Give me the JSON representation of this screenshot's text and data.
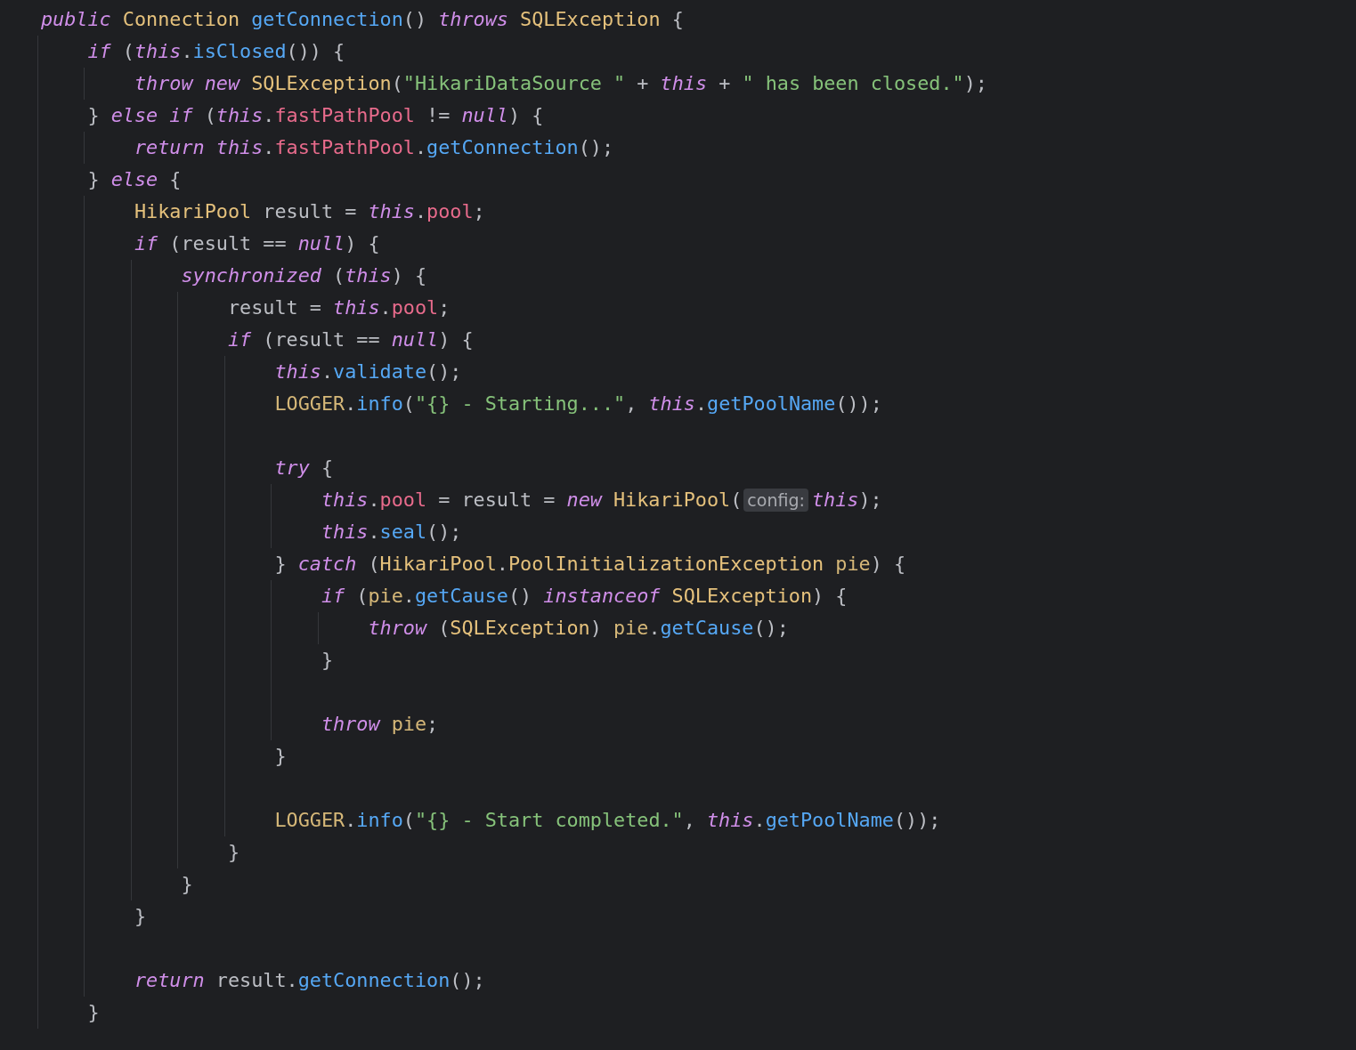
{
  "editor": {
    "lines": [
      {
        "tokens": [
          {
            "kind": "keyword",
            "text": "public"
          },
          {
            "kind": "type",
            "text": "Connection",
            "space_before": true
          },
          {
            "kind": "method",
            "text": "getConnection",
            "space_before": true
          },
          {
            "kind": "plain",
            "text": "() "
          },
          {
            "kind": "keyword",
            "text": "throws"
          },
          {
            "kind": "type",
            "text": "SQLException",
            "space_before": true
          },
          {
            "kind": "plain",
            "text": " {"
          }
        ],
        "children": [
          {
            "tokens": [
              {
                "kind": "keyword",
                "text": "if"
              },
              {
                "kind": "plain",
                "text": " ("
              },
              {
                "kind": "keyword",
                "text": "this"
              },
              {
                "kind": "plain",
                "text": "."
              },
              {
                "kind": "method",
                "text": "isClosed"
              },
              {
                "kind": "plain",
                "text": "()) {"
              }
            ],
            "children": [
              {
                "tokens": [
                  {
                    "kind": "keyword",
                    "text": "throw"
                  },
                  {
                    "kind": "keyword",
                    "text": "new",
                    "space_before": true
                  },
                  {
                    "kind": "type",
                    "text": "SQLException",
                    "space_before": true
                  },
                  {
                    "kind": "plain",
                    "text": "("
                  },
                  {
                    "kind": "string",
                    "text": "\"HikariDataSource \""
                  },
                  {
                    "kind": "plain",
                    "text": " + "
                  },
                  {
                    "kind": "keyword",
                    "text": "this"
                  },
                  {
                    "kind": "plain",
                    "text": " + "
                  },
                  {
                    "kind": "string",
                    "text": "\" has been closed.\""
                  },
                  {
                    "kind": "plain",
                    "text": ");"
                  }
                ]
              }
            ]
          },
          {
            "tokens": [
              {
                "kind": "plain",
                "text": "} "
              },
              {
                "kind": "keyword",
                "text": "else if"
              },
              {
                "kind": "plain",
                "text": " ("
              },
              {
                "kind": "keyword",
                "text": "this"
              },
              {
                "kind": "plain",
                "text": "."
              },
              {
                "kind": "field",
                "text": "fastPathPool"
              },
              {
                "kind": "plain",
                "text": " != "
              },
              {
                "kind": "keyword",
                "text": "null"
              },
              {
                "kind": "plain",
                "text": ") {"
              }
            ],
            "children": [
              {
                "tokens": [
                  {
                    "kind": "keyword",
                    "text": "return"
                  },
                  {
                    "kind": "keyword",
                    "text": "this",
                    "space_before": true
                  },
                  {
                    "kind": "plain",
                    "text": "."
                  },
                  {
                    "kind": "field",
                    "text": "fastPathPool"
                  },
                  {
                    "kind": "plain",
                    "text": "."
                  },
                  {
                    "kind": "method",
                    "text": "getConnection"
                  },
                  {
                    "kind": "plain",
                    "text": "();"
                  }
                ]
              }
            ]
          },
          {
            "tokens": [
              {
                "kind": "plain",
                "text": "} "
              },
              {
                "kind": "keyword",
                "text": "else"
              },
              {
                "kind": "plain",
                "text": " {"
              }
            ],
            "children": [
              {
                "tokens": [
                  {
                    "kind": "type",
                    "text": "HikariPool"
                  },
                  {
                    "kind": "plain",
                    "text": " result = "
                  },
                  {
                    "kind": "keyword",
                    "text": "this"
                  },
                  {
                    "kind": "plain",
                    "text": "."
                  },
                  {
                    "kind": "field",
                    "text": "pool"
                  },
                  {
                    "kind": "plain",
                    "text": ";"
                  }
                ]
              },
              {
                "tokens": [
                  {
                    "kind": "keyword",
                    "text": "if"
                  },
                  {
                    "kind": "plain",
                    "text": " (result == "
                  },
                  {
                    "kind": "keyword",
                    "text": "null"
                  },
                  {
                    "kind": "plain",
                    "text": ") {"
                  }
                ],
                "children": [
                  {
                    "tokens": [
                      {
                        "kind": "keyword",
                        "text": "synchronized"
                      },
                      {
                        "kind": "plain",
                        "text": " ("
                      },
                      {
                        "kind": "keyword",
                        "text": "this"
                      },
                      {
                        "kind": "plain",
                        "text": ") {"
                      }
                    ],
                    "children": [
                      {
                        "tokens": [
                          {
                            "kind": "plain",
                            "text": "result = "
                          },
                          {
                            "kind": "keyword",
                            "text": "this"
                          },
                          {
                            "kind": "plain",
                            "text": "."
                          },
                          {
                            "kind": "field",
                            "text": "pool"
                          },
                          {
                            "kind": "plain",
                            "text": ";"
                          }
                        ]
                      },
                      {
                        "tokens": [
                          {
                            "kind": "keyword",
                            "text": "if"
                          },
                          {
                            "kind": "plain",
                            "text": " (result == "
                          },
                          {
                            "kind": "keyword",
                            "text": "null"
                          },
                          {
                            "kind": "plain",
                            "text": ") {"
                          }
                        ],
                        "children": [
                          {
                            "tokens": [
                              {
                                "kind": "keyword",
                                "text": "this"
                              },
                              {
                                "kind": "plain",
                                "text": "."
                              },
                              {
                                "kind": "method",
                                "text": "validate"
                              },
                              {
                                "kind": "plain",
                                "text": "();"
                              }
                            ]
                          },
                          {
                            "tokens": [
                              {
                                "kind": "variable",
                                "text": "LOGGER"
                              },
                              {
                                "kind": "plain",
                                "text": "."
                              },
                              {
                                "kind": "method",
                                "text": "info"
                              },
                              {
                                "kind": "plain",
                                "text": "("
                              },
                              {
                                "kind": "string",
                                "text": "\"{} - Starting...\""
                              },
                              {
                                "kind": "plain",
                                "text": ", "
                              },
                              {
                                "kind": "keyword",
                                "text": "this"
                              },
                              {
                                "kind": "plain",
                                "text": "."
                              },
                              {
                                "kind": "method",
                                "text": "getPoolName"
                              },
                              {
                                "kind": "plain",
                                "text": "());"
                              }
                            ]
                          },
                          {
                            "blank": true
                          },
                          {
                            "tokens": [
                              {
                                "kind": "keyword",
                                "text": "try"
                              },
                              {
                                "kind": "plain",
                                "text": " {"
                              }
                            ],
                            "children": [
                              {
                                "tokens": [
                                  {
                                    "kind": "keyword",
                                    "text": "this"
                                  },
                                  {
                                    "kind": "plain",
                                    "text": "."
                                  },
                                  {
                                    "kind": "field",
                                    "text": "pool"
                                  },
                                  {
                                    "kind": "plain",
                                    "text": " = result = "
                                  },
                                  {
                                    "kind": "keyword",
                                    "text": "new"
                                  },
                                  {
                                    "kind": "type",
                                    "text": "HikariPool",
                                    "space_before": true
                                  },
                                  {
                                    "kind": "plain",
                                    "text": "("
                                  },
                                  {
                                    "kind": "hint",
                                    "text": "config:"
                                  },
                                  {
                                    "kind": "keyword",
                                    "text": "this"
                                  },
                                  {
                                    "kind": "plain",
                                    "text": ");"
                                  }
                                ]
                              },
                              {
                                "tokens": [
                                  {
                                    "kind": "keyword",
                                    "text": "this"
                                  },
                                  {
                                    "kind": "plain",
                                    "text": "."
                                  },
                                  {
                                    "kind": "method",
                                    "text": "seal"
                                  },
                                  {
                                    "kind": "plain",
                                    "text": "();"
                                  }
                                ]
                              }
                            ]
                          },
                          {
                            "tokens": [
                              {
                                "kind": "plain",
                                "text": "} "
                              },
                              {
                                "kind": "keyword",
                                "text": "catch"
                              },
                              {
                                "kind": "plain",
                                "text": " ("
                              },
                              {
                                "kind": "type",
                                "text": "HikariPool"
                              },
                              {
                                "kind": "plain",
                                "text": "."
                              },
                              {
                                "kind": "type",
                                "text": "PoolInitializationException"
                              },
                              {
                                "kind": "variable",
                                "text": "pie",
                                "space_before": true
                              },
                              {
                                "kind": "plain",
                                "text": ") {"
                              }
                            ],
                            "children": [
                              {
                                "tokens": [
                                  {
                                    "kind": "keyword",
                                    "text": "if"
                                  },
                                  {
                                    "kind": "plain",
                                    "text": " ("
                                  },
                                  {
                                    "kind": "variable",
                                    "text": "pie"
                                  },
                                  {
                                    "kind": "plain",
                                    "text": "."
                                  },
                                  {
                                    "kind": "method",
                                    "text": "getCause"
                                  },
                                  {
                                    "kind": "plain",
                                    "text": "() "
                                  },
                                  {
                                    "kind": "keyword",
                                    "text": "instanceof"
                                  },
                                  {
                                    "kind": "type",
                                    "text": "SQLException",
                                    "space_before": true
                                  },
                                  {
                                    "kind": "plain",
                                    "text": ") {"
                                  }
                                ],
                                "children": [
                                  {
                                    "tokens": [
                                      {
                                        "kind": "keyword",
                                        "text": "throw"
                                      },
                                      {
                                        "kind": "plain",
                                        "text": " ("
                                      },
                                      {
                                        "kind": "type",
                                        "text": "SQLException"
                                      },
                                      {
                                        "kind": "plain",
                                        "text": ") "
                                      },
                                      {
                                        "kind": "variable",
                                        "text": "pie"
                                      },
                                      {
                                        "kind": "plain",
                                        "text": "."
                                      },
                                      {
                                        "kind": "method",
                                        "text": "getCause"
                                      },
                                      {
                                        "kind": "plain",
                                        "text": "();"
                                      }
                                    ]
                                  }
                                ]
                              },
                              {
                                "tokens": [
                                  {
                                    "kind": "plain",
                                    "text": "}"
                                  }
                                ]
                              },
                              {
                                "blank": true
                              },
                              {
                                "tokens": [
                                  {
                                    "kind": "keyword",
                                    "text": "throw"
                                  },
                                  {
                                    "kind": "variable",
                                    "text": "pie",
                                    "space_before": true
                                  },
                                  {
                                    "kind": "plain",
                                    "text": ";"
                                  }
                                ]
                              }
                            ]
                          },
                          {
                            "tokens": [
                              {
                                "kind": "plain",
                                "text": "}"
                              }
                            ]
                          },
                          {
                            "blank": true
                          },
                          {
                            "tokens": [
                              {
                                "kind": "variable",
                                "text": "LOGGER"
                              },
                              {
                                "kind": "plain",
                                "text": "."
                              },
                              {
                                "kind": "method",
                                "text": "info"
                              },
                              {
                                "kind": "plain",
                                "text": "("
                              },
                              {
                                "kind": "string",
                                "text": "\"{} - Start completed.\""
                              },
                              {
                                "kind": "plain",
                                "text": ", "
                              },
                              {
                                "kind": "keyword",
                                "text": "this"
                              },
                              {
                                "kind": "plain",
                                "text": "."
                              },
                              {
                                "kind": "method",
                                "text": "getPoolName"
                              },
                              {
                                "kind": "plain",
                                "text": "());"
                              }
                            ]
                          }
                        ]
                      },
                      {
                        "tokens": [
                          {
                            "kind": "plain",
                            "text": "}"
                          }
                        ]
                      }
                    ]
                  },
                  {
                    "tokens": [
                      {
                        "kind": "plain",
                        "text": "}"
                      }
                    ]
                  }
                ]
              },
              {
                "tokens": [
                  {
                    "kind": "plain",
                    "text": "}"
                  }
                ]
              },
              {
                "blank": true
              },
              {
                "tokens": [
                  {
                    "kind": "keyword",
                    "text": "return"
                  },
                  {
                    "kind": "plain",
                    "text": " result."
                  },
                  {
                    "kind": "method",
                    "text": "getConnection"
                  },
                  {
                    "kind": "plain",
                    "text": "();"
                  }
                ]
              }
            ]
          },
          {
            "tokens": [
              {
                "kind": "plain",
                "text": "}"
              }
            ]
          }
        ]
      }
    ]
  }
}
